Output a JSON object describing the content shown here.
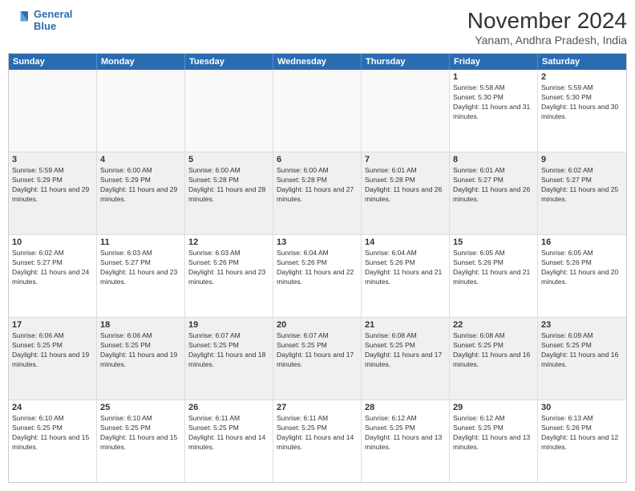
{
  "header": {
    "logo_line1": "General",
    "logo_line2": "Blue",
    "month_title": "November 2024",
    "location": "Yanam, Andhra Pradesh, India"
  },
  "weekdays": [
    "Sunday",
    "Monday",
    "Tuesday",
    "Wednesday",
    "Thursday",
    "Friday",
    "Saturday"
  ],
  "rows": [
    [
      {
        "day": "",
        "text": "",
        "empty": true
      },
      {
        "day": "",
        "text": "",
        "empty": true
      },
      {
        "day": "",
        "text": "",
        "empty": true
      },
      {
        "day": "",
        "text": "",
        "empty": true
      },
      {
        "day": "",
        "text": "",
        "empty": true
      },
      {
        "day": "1",
        "text": "Sunrise: 5:58 AM\nSunset: 5:30 PM\nDaylight: 11 hours and 31 minutes.",
        "empty": false
      },
      {
        "day": "2",
        "text": "Sunrise: 5:59 AM\nSunset: 5:30 PM\nDaylight: 11 hours and 30 minutes.",
        "empty": false
      }
    ],
    [
      {
        "day": "3",
        "text": "Sunrise: 5:59 AM\nSunset: 5:29 PM\nDaylight: 11 hours and 29 minutes.",
        "empty": false
      },
      {
        "day": "4",
        "text": "Sunrise: 6:00 AM\nSunset: 5:29 PM\nDaylight: 11 hours and 29 minutes.",
        "empty": false
      },
      {
        "day": "5",
        "text": "Sunrise: 6:00 AM\nSunset: 5:28 PM\nDaylight: 11 hours and 28 minutes.",
        "empty": false
      },
      {
        "day": "6",
        "text": "Sunrise: 6:00 AM\nSunset: 5:28 PM\nDaylight: 11 hours and 27 minutes.",
        "empty": false
      },
      {
        "day": "7",
        "text": "Sunrise: 6:01 AM\nSunset: 5:28 PM\nDaylight: 11 hours and 26 minutes.",
        "empty": false
      },
      {
        "day": "8",
        "text": "Sunrise: 6:01 AM\nSunset: 5:27 PM\nDaylight: 11 hours and 26 minutes.",
        "empty": false
      },
      {
        "day": "9",
        "text": "Sunrise: 6:02 AM\nSunset: 5:27 PM\nDaylight: 11 hours and 25 minutes.",
        "empty": false
      }
    ],
    [
      {
        "day": "10",
        "text": "Sunrise: 6:02 AM\nSunset: 5:27 PM\nDaylight: 11 hours and 24 minutes.",
        "empty": false
      },
      {
        "day": "11",
        "text": "Sunrise: 6:03 AM\nSunset: 5:27 PM\nDaylight: 11 hours and 23 minutes.",
        "empty": false
      },
      {
        "day": "12",
        "text": "Sunrise: 6:03 AM\nSunset: 5:26 PM\nDaylight: 11 hours and 23 minutes.",
        "empty": false
      },
      {
        "day": "13",
        "text": "Sunrise: 6:04 AM\nSunset: 5:26 PM\nDaylight: 11 hours and 22 minutes.",
        "empty": false
      },
      {
        "day": "14",
        "text": "Sunrise: 6:04 AM\nSunset: 5:26 PM\nDaylight: 11 hours and 21 minutes.",
        "empty": false
      },
      {
        "day": "15",
        "text": "Sunrise: 6:05 AM\nSunset: 5:26 PM\nDaylight: 11 hours and 21 minutes.",
        "empty": false
      },
      {
        "day": "16",
        "text": "Sunrise: 6:05 AM\nSunset: 5:26 PM\nDaylight: 11 hours and 20 minutes.",
        "empty": false
      }
    ],
    [
      {
        "day": "17",
        "text": "Sunrise: 6:06 AM\nSunset: 5:25 PM\nDaylight: 11 hours and 19 minutes.",
        "empty": false
      },
      {
        "day": "18",
        "text": "Sunrise: 6:06 AM\nSunset: 5:25 PM\nDaylight: 11 hours and 19 minutes.",
        "empty": false
      },
      {
        "day": "19",
        "text": "Sunrise: 6:07 AM\nSunset: 5:25 PM\nDaylight: 11 hours and 18 minutes.",
        "empty": false
      },
      {
        "day": "20",
        "text": "Sunrise: 6:07 AM\nSunset: 5:25 PM\nDaylight: 11 hours and 17 minutes.",
        "empty": false
      },
      {
        "day": "21",
        "text": "Sunrise: 6:08 AM\nSunset: 5:25 PM\nDaylight: 11 hours and 17 minutes.",
        "empty": false
      },
      {
        "day": "22",
        "text": "Sunrise: 6:08 AM\nSunset: 5:25 PM\nDaylight: 11 hours and 16 minutes.",
        "empty": false
      },
      {
        "day": "23",
        "text": "Sunrise: 6:09 AM\nSunset: 5:25 PM\nDaylight: 11 hours and 16 minutes.",
        "empty": false
      }
    ],
    [
      {
        "day": "24",
        "text": "Sunrise: 6:10 AM\nSunset: 5:25 PM\nDaylight: 11 hours and 15 minutes.",
        "empty": false
      },
      {
        "day": "25",
        "text": "Sunrise: 6:10 AM\nSunset: 5:25 PM\nDaylight: 11 hours and 15 minutes.",
        "empty": false
      },
      {
        "day": "26",
        "text": "Sunrise: 6:11 AM\nSunset: 5:25 PM\nDaylight: 11 hours and 14 minutes.",
        "empty": false
      },
      {
        "day": "27",
        "text": "Sunrise: 6:11 AM\nSunset: 5:25 PM\nDaylight: 11 hours and 14 minutes.",
        "empty": false
      },
      {
        "day": "28",
        "text": "Sunrise: 6:12 AM\nSunset: 5:25 PM\nDaylight: 11 hours and 13 minutes.",
        "empty": false
      },
      {
        "day": "29",
        "text": "Sunrise: 6:12 AM\nSunset: 5:25 PM\nDaylight: 11 hours and 13 minutes.",
        "empty": false
      },
      {
        "day": "30",
        "text": "Sunrise: 6:13 AM\nSunset: 5:26 PM\nDaylight: 11 hours and 12 minutes.",
        "empty": false
      }
    ]
  ]
}
